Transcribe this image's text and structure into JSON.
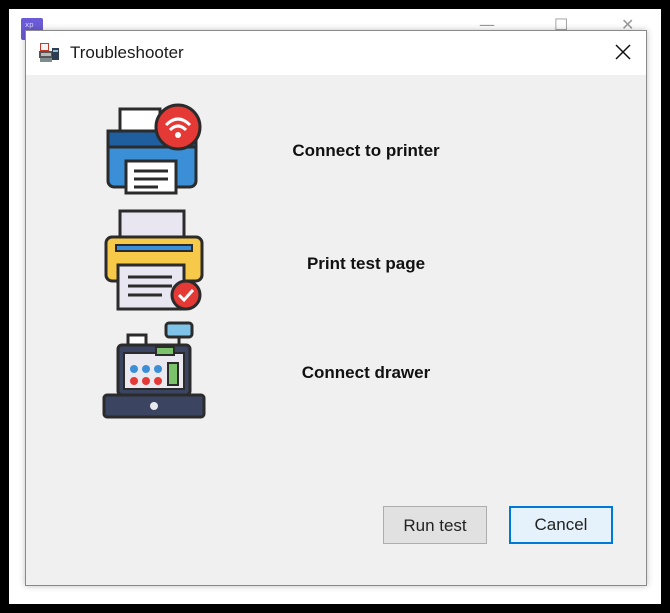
{
  "window": {
    "title": "Troubleshooter",
    "close_glyph": "×"
  },
  "background": {
    "icon": "app-icon",
    "minimize_glyph": "—",
    "maximize_glyph": "☐",
    "close_glyph": "✕"
  },
  "tasks": [
    {
      "label": "Connect to printer",
      "icon": "printer-wifi-icon"
    },
    {
      "label": "Print test page",
      "icon": "printer-check-icon"
    },
    {
      "label": "Connect drawer",
      "icon": "cash-register-icon"
    }
  ],
  "buttons": {
    "run_test": "Run test",
    "cancel": "Cancel"
  },
  "colors": {
    "accent_border": "#0078d7",
    "wifi_badge": "#e53935",
    "check_badge": "#e53935",
    "printer_blue": "#3a8fd6",
    "printer_yellow": "#f7c948",
    "register_navy": "#3b4460"
  }
}
